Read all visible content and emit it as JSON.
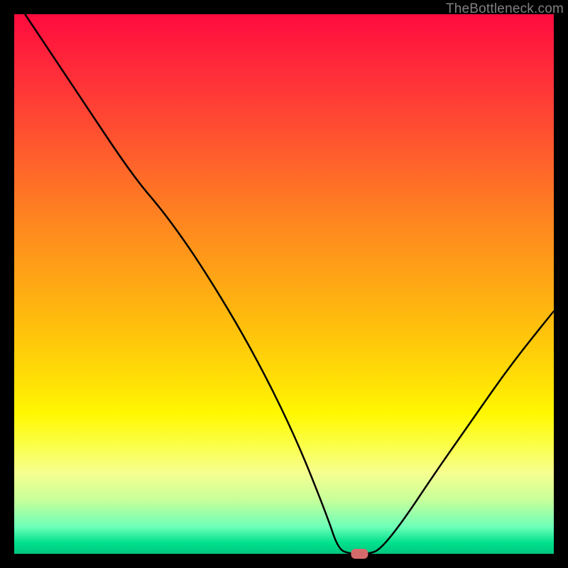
{
  "watermark": "TheBottleneck.com",
  "chart_data": {
    "type": "line",
    "title": "",
    "xlabel": "",
    "ylabel": "",
    "xlim": [
      0,
      100
    ],
    "ylim": [
      0,
      100
    ],
    "grid": false,
    "curve": [
      {
        "x": 2,
        "y": 100
      },
      {
        "x": 12,
        "y": 85
      },
      {
        "x": 22,
        "y": 70
      },
      {
        "x": 28,
        "y": 63
      },
      {
        "x": 35,
        "y": 53
      },
      {
        "x": 44,
        "y": 38
      },
      {
        "x": 52,
        "y": 22
      },
      {
        "x": 58,
        "y": 7
      },
      {
        "x": 60,
        "y": 1
      },
      {
        "x": 62,
        "y": 0
      },
      {
        "x": 66,
        "y": 0
      },
      {
        "x": 68,
        "y": 1
      },
      {
        "x": 72,
        "y": 6
      },
      {
        "x": 78,
        "y": 15
      },
      {
        "x": 85,
        "y": 25
      },
      {
        "x": 92,
        "y": 35
      },
      {
        "x": 100,
        "y": 45
      }
    ],
    "marker": {
      "x": 64,
      "y": 0,
      "color": "#d46a6a"
    }
  }
}
